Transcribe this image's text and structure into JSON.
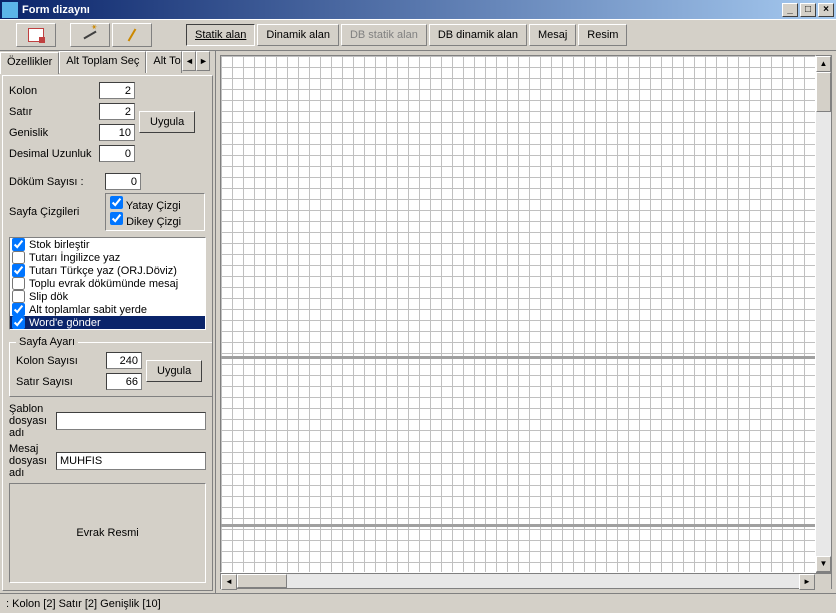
{
  "window": {
    "title": "Form dizaynı"
  },
  "toolbar": {
    "modes": {
      "static": "Statik alan",
      "dynamic": "Dinamik alan",
      "dbstatic": "DB statik alan",
      "dbdynamic": "DB dinamik alan",
      "message": "Mesaj",
      "image": "Resim"
    }
  },
  "tabs": {
    "ozellikler": "Özellikler",
    "alttoplam": "Alt Toplam Seç",
    "altto": "Alt To"
  },
  "props": {
    "kolon_label": "Kolon",
    "kolon": "2",
    "satir_label": "Satır",
    "satir": "2",
    "genislik_label": "Genislik",
    "genislik": "10",
    "desimal_label": "Desimal Uzunluk",
    "desimal": "0",
    "uygula": "Uygula",
    "dokum_label": "Döküm Sayısı :",
    "dokum": "0",
    "sayfa_cizgi_label": "Sayfa Çizgileri",
    "yatay": "Yatay Çizgi",
    "dikey": "Dikey Çizgi"
  },
  "checks": [
    {
      "label": "Stok birleştir",
      "checked": true
    },
    {
      "label": "Tutarı İngilizce yaz",
      "checked": false
    },
    {
      "label": "Tutarı Türkçe yaz (ORJ.Döviz)",
      "checked": true
    },
    {
      "label": "Toplu evrak dökümünde mesaj",
      "checked": false
    },
    {
      "label": "Slip dök",
      "checked": false
    },
    {
      "label": "Alt toplamlar sabit yerde",
      "checked": true
    },
    {
      "label": "Word'e gönder",
      "checked": true,
      "selected": true
    }
  ],
  "page_settings": {
    "legend": "Sayfa Ayarı",
    "kolon_sayisi_label": "Kolon Sayısı",
    "kolon_sayisi": "240",
    "satir_sayisi_label": "Satır Sayısı",
    "satir_sayisi": "66",
    "uygula": "Uygula"
  },
  "files": {
    "sablon_label": "Şablon dosyası adı",
    "sablon": "",
    "mesaj_label": "Mesaj dosyası adı",
    "mesaj": "MUHFIS"
  },
  "evrak": {
    "label": "Evrak Resmi"
  },
  "canvas": {
    "corner": "<<"
  },
  "status": {
    "text": ": Kolon [2]  Satır [2]  Genişlik [10]"
  }
}
